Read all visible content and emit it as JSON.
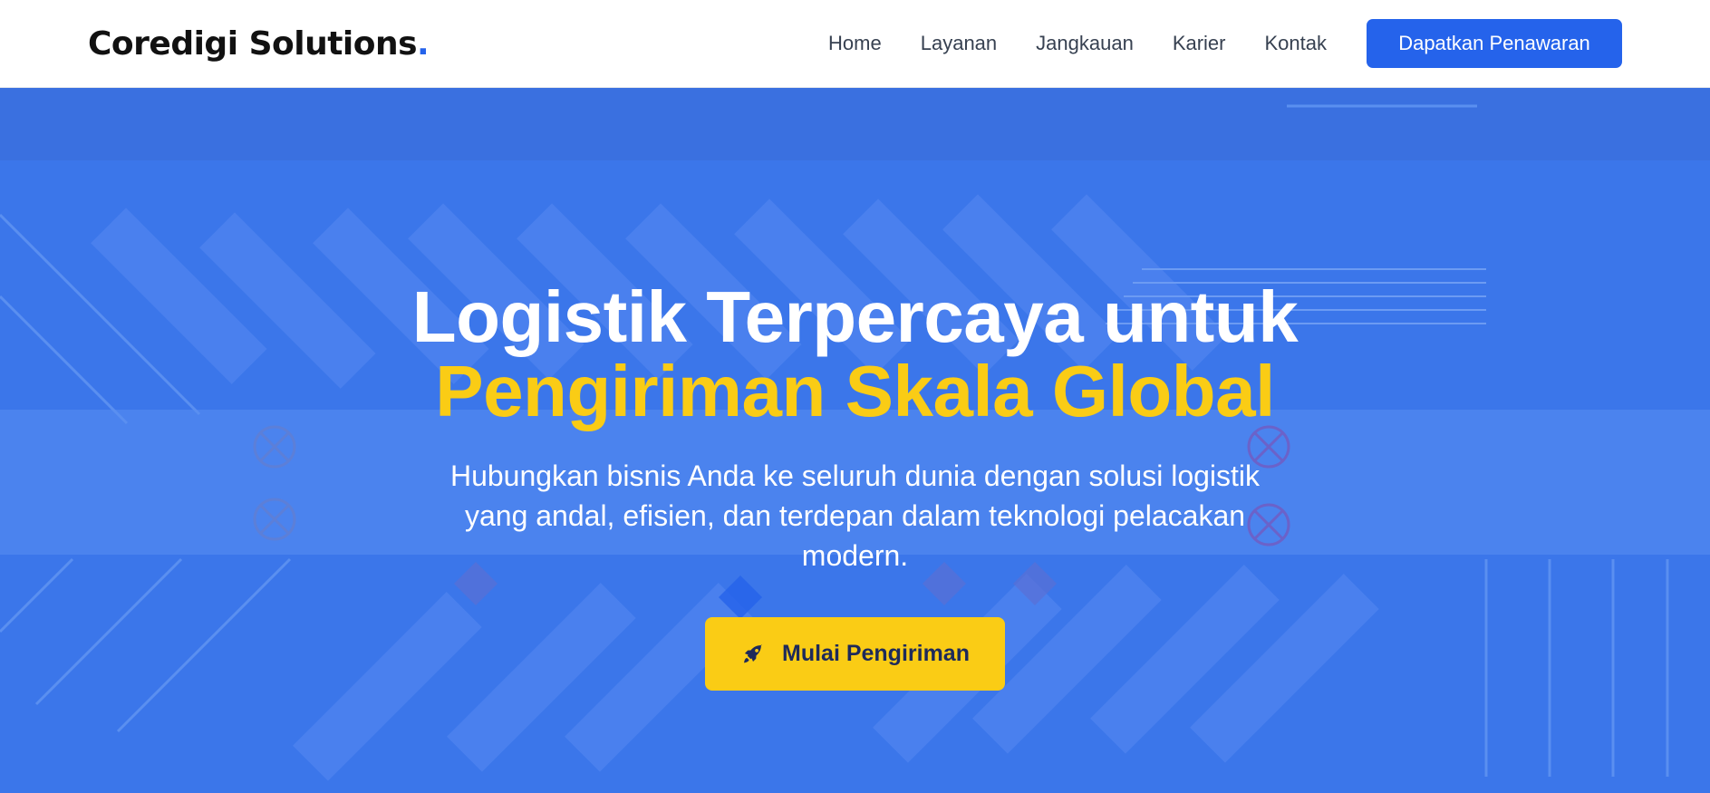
{
  "brand": {
    "name": "Coredigi Solutions",
    "dot": "."
  },
  "nav": {
    "links": [
      "Home",
      "Layanan",
      "Jangkauan",
      "Karier",
      "Kontak"
    ],
    "cta_label": "Dapatkan Penawaran"
  },
  "hero": {
    "title_line1": "Logistik Terpercaya untuk",
    "title_line2": "Pengiriman Skala Global",
    "subtitle": "Hubungkan bisnis Anda ke seluruh dunia dengan solusi logistik yang andal, efisien, dan terdepan dalam teknologi pelacakan modern.",
    "button_label": "Mulai Pengiriman",
    "button_icon": "rocket-icon"
  },
  "colors": {
    "accent_blue": "#2563eb",
    "hero_overlay": "#3b76ea",
    "highlight_yellow": "#facc15",
    "button_text": "#1e2a5a"
  }
}
